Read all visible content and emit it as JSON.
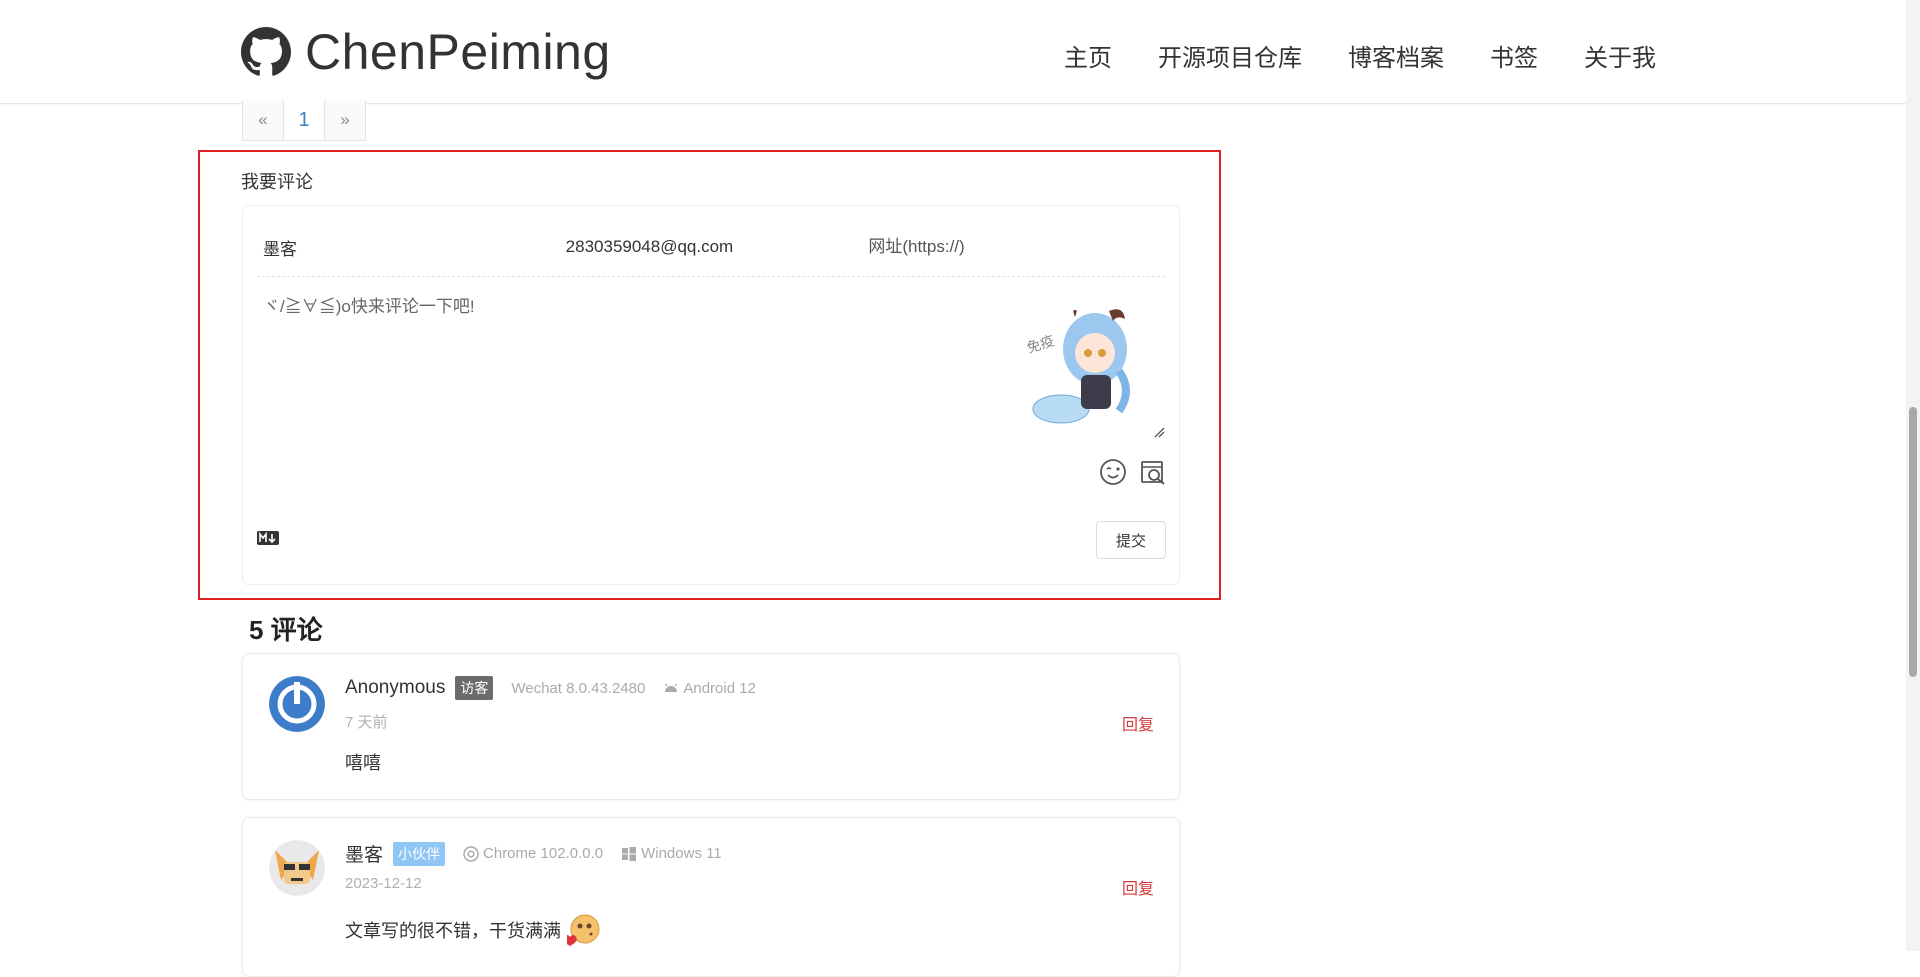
{
  "header": {
    "brand": "ChenPeiming",
    "nav": [
      "主页",
      "开源项目仓库",
      "博客档案",
      "书签",
      "关于我"
    ]
  },
  "pagination": {
    "prev": "«",
    "current": "1",
    "next": "»"
  },
  "comment_form": {
    "title": "我要评论",
    "nickname_value": "墨客",
    "email_value": "2830359048@qq.com",
    "website_placeholder": "网址(https://)",
    "textarea_placeholder": "ヾ/≧∀≦)o快来评论一下吧!",
    "submit_label": "提交",
    "mascot_text": "免疫"
  },
  "comments_header": "5 评论",
  "comments": [
    {
      "name": "Anonymous",
      "badge": "访客",
      "browser": "Wechat 8.0.43.2480",
      "os": "Android 12",
      "time": "7 天前",
      "reply": "回复",
      "text": "嘻嘻"
    },
    {
      "name": "墨客",
      "badge": "小伙伴",
      "browser": "Chrome 102.0.0.0",
      "os": "Windows 11",
      "time": "2023-12-12",
      "reply": "回复",
      "text": "文章写的很不错，干货满满"
    }
  ],
  "colors": {
    "reply": "#d63a3a",
    "highlight_border": "#e02020",
    "guest_badge": "#6b6b6b",
    "friend_badge": "#8fc6f5"
  }
}
